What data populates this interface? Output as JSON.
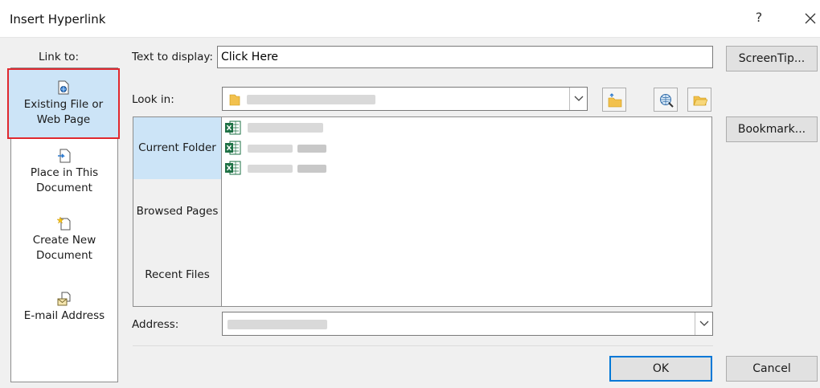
{
  "dialog": {
    "title": "Insert Hyperlink",
    "help": "?",
    "close": "✕"
  },
  "link_to": {
    "label": "Link to:",
    "items": [
      {
        "label_line1": "Existing File or",
        "label_line2": "Web Page",
        "selected": true
      },
      {
        "label_line1": "Place in This",
        "label_line2": "Document",
        "selected": false
      },
      {
        "label_line1": "Create New",
        "label_line2": "Document",
        "selected": false
      },
      {
        "label_line1": "E-mail Address",
        "label_line2": "",
        "selected": false
      }
    ]
  },
  "text_to_display": {
    "label": "Text to display:",
    "value": "Click Here"
  },
  "screentip_button": "ScreenTip...",
  "look_in": {
    "label": "Look in:"
  },
  "bookmark_button": "Bookmark...",
  "nav": {
    "current_folder": "Current Folder",
    "browsed_pages": "Browsed Pages",
    "recent_files": "Recent Files"
  },
  "address": {
    "label": "Address:"
  },
  "ok_button": "OK",
  "cancel_button": "Cancel",
  "colors": {
    "selection": "#cce4f7",
    "highlight_border": "#e0282e",
    "primary_border": "#0078d7"
  }
}
